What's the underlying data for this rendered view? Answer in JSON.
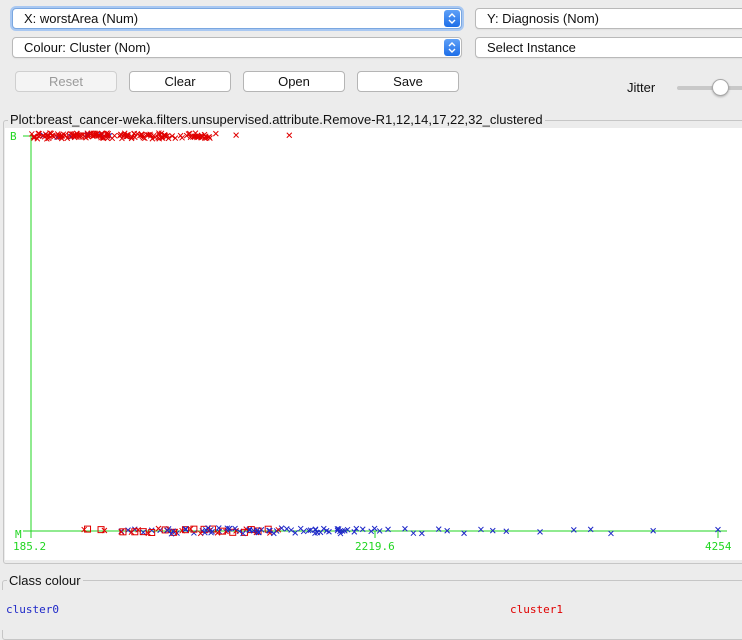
{
  "controls": {
    "x_axis": "X: worstArea (Num)",
    "y_axis": "Y: Diagnosis (Nom)",
    "colour": "Colour: Cluster (Nom)",
    "select_instance": "Select Instance",
    "buttons": {
      "reset": "Reset",
      "clear": "Clear",
      "open": "Open",
      "save": "Save"
    },
    "jitter_label": "Jitter",
    "jitter_level": 0.5
  },
  "plot": {
    "title": "Plot:breast_cancer-weka.filters.unsupervised.attribute.Remove-R1,12,14,17,22,32_clustered",
    "y_tick_top": "B",
    "y_tick_bottom": "M",
    "x_tick_min": "185.2",
    "x_tick_mid": "2219.6",
    "x_tick_max": "4254"
  },
  "colors": {
    "cluster0": "#1e28c8",
    "cluster1": "#e00000",
    "axis": "#22d622",
    "combo_arrow": "#1d6ee8"
  },
  "legend": {
    "title": "Class colour",
    "items": [
      {
        "label": "cluster0",
        "color": "#1e28c8"
      },
      {
        "label": "cluster1",
        "color": "#e00000"
      }
    ]
  },
  "chart_data": {
    "type": "scatter",
    "title": "Plot:breast_cancer-weka.filters.unsupervised.attribute.Remove-R1,12,14,17,22,32_clustered",
    "xlabel": "worstArea",
    "ylabel": "Diagnosis",
    "xlim": [
      185.2,
      4254
    ],
    "y_categories": [
      "M",
      "B"
    ],
    "grid": false,
    "legend_position": "bottom",
    "series": [
      {
        "name": "cluster0",
        "color": "#1e28c8",
        "points": [
          [
            1350,
            "M"
          ],
          [
            1420,
            "M"
          ],
          [
            1480,
            "M"
          ],
          [
            1550,
            "M"
          ],
          [
            1600,
            "M"
          ],
          [
            1640,
            "M"
          ],
          [
            1700,
            "M"
          ],
          [
            1750,
            "M"
          ],
          [
            1800,
            "M"
          ],
          [
            1830,
            "M"
          ],
          [
            1870,
            "M"
          ],
          [
            1900,
            "M"
          ],
          [
            1950,
            "M"
          ],
          [
            2000,
            "M"
          ],
          [
            2030,
            "M"
          ],
          [
            2060,
            "M"
          ],
          [
            2100,
            "M"
          ],
          [
            2150,
            "M"
          ],
          [
            2200,
            "M"
          ],
          [
            2250,
            "M"
          ],
          [
            2300,
            "M"
          ],
          [
            2400,
            "M"
          ],
          [
            2450,
            "M"
          ],
          [
            2500,
            "M"
          ],
          [
            2600,
            "M"
          ],
          [
            2650,
            "M"
          ],
          [
            2750,
            "M"
          ],
          [
            2850,
            "M"
          ],
          [
            2920,
            "M"
          ],
          [
            3000,
            "M"
          ],
          [
            3200,
            "M"
          ],
          [
            3400,
            "M"
          ],
          [
            3500,
            "M"
          ],
          [
            3620,
            "M"
          ],
          [
            3870,
            "M"
          ],
          [
            4254,
            "M"
          ],
          [
            720,
            "M"
          ],
          [
            760,
            "M"
          ],
          [
            800,
            "M"
          ],
          [
            850,
            "M"
          ],
          [
            900,
            "M"
          ],
          [
            950,
            "M"
          ],
          [
            1000,
            "M"
          ],
          [
            1050,
            "M"
          ],
          [
            1100,
            "M"
          ],
          [
            1150,
            "M"
          ],
          [
            1200,
            "M"
          ],
          [
            1250,
            "M"
          ],
          [
            1300,
            "M"
          ],
          [
            260,
            "B"
          ],
          [
            340,
            "B"
          ],
          [
            420,
            "B"
          ],
          [
            520,
            "B"
          ],
          [
            600,
            "B"
          ],
          [
            650,
            "B"
          ]
        ]
      },
      {
        "name": "cluster1",
        "color": "#e00000",
        "points": [
          [
            190,
            "B"
          ],
          [
            230,
            "B"
          ],
          [
            280,
            "B"
          ],
          [
            320,
            "B"
          ],
          [
            360,
            "B"
          ],
          [
            400,
            "B"
          ],
          [
            440,
            "B"
          ],
          [
            480,
            "B"
          ],
          [
            520,
            "B"
          ],
          [
            560,
            "B"
          ],
          [
            600,
            "B"
          ],
          [
            640,
            "B"
          ],
          [
            680,
            "B"
          ],
          [
            720,
            "B"
          ],
          [
            760,
            "B"
          ],
          [
            800,
            "B"
          ],
          [
            840,
            "B"
          ],
          [
            880,
            "B"
          ],
          [
            920,
            "B"
          ],
          [
            960,
            "B"
          ],
          [
            1000,
            "B"
          ],
          [
            1040,
            "B"
          ],
          [
            1080,
            "B"
          ],
          [
            1130,
            "B"
          ],
          [
            1180,
            "B"
          ],
          [
            1220,
            "B"
          ],
          [
            1280,
            "B"
          ],
          [
            1400,
            "B"
          ],
          [
            1715,
            "B"
          ],
          [
            500,
            "M"
          ],
          [
            620,
            "M"
          ],
          [
            720,
            "M"
          ],
          [
            780,
            "M"
          ],
          [
            820,
            "M"
          ],
          [
            880,
            "M"
          ],
          [
            940,
            "M"
          ],
          [
            990,
            "M"
          ],
          [
            1040,
            "M"
          ],
          [
            1080,
            "M"
          ],
          [
            1130,
            "M"
          ],
          [
            1190,
            "M"
          ],
          [
            1240,
            "M"
          ],
          [
            1290,
            "M"
          ],
          [
            1340,
            "M"
          ],
          [
            1400,
            "M"
          ],
          [
            1460,
            "M"
          ],
          [
            1520,
            "M"
          ],
          [
            1600,
            "M"
          ],
          [
            1650,
            "M"
          ]
        ],
        "box_points": [
          [
            520,
            "M"
          ],
          [
            600,
            "M"
          ],
          [
            730,
            "M"
          ],
          [
            800,
            "M"
          ],
          [
            850,
            "M"
          ],
          [
            900,
            "M"
          ],
          [
            980,
            "M"
          ],
          [
            1030,
            "M"
          ],
          [
            1100,
            "M"
          ],
          [
            1150,
            "M"
          ],
          [
            1210,
            "M"
          ],
          [
            1260,
            "M"
          ],
          [
            1320,
            "M"
          ],
          [
            1380,
            "M"
          ],
          [
            1450,
            "M"
          ],
          [
            1490,
            "M"
          ],
          [
            1530,
            "M"
          ],
          [
            1590,
            "M"
          ],
          [
            420,
            "B"
          ],
          [
            480,
            "B"
          ],
          [
            560,
            "B"
          ]
        ]
      }
    ]
  }
}
